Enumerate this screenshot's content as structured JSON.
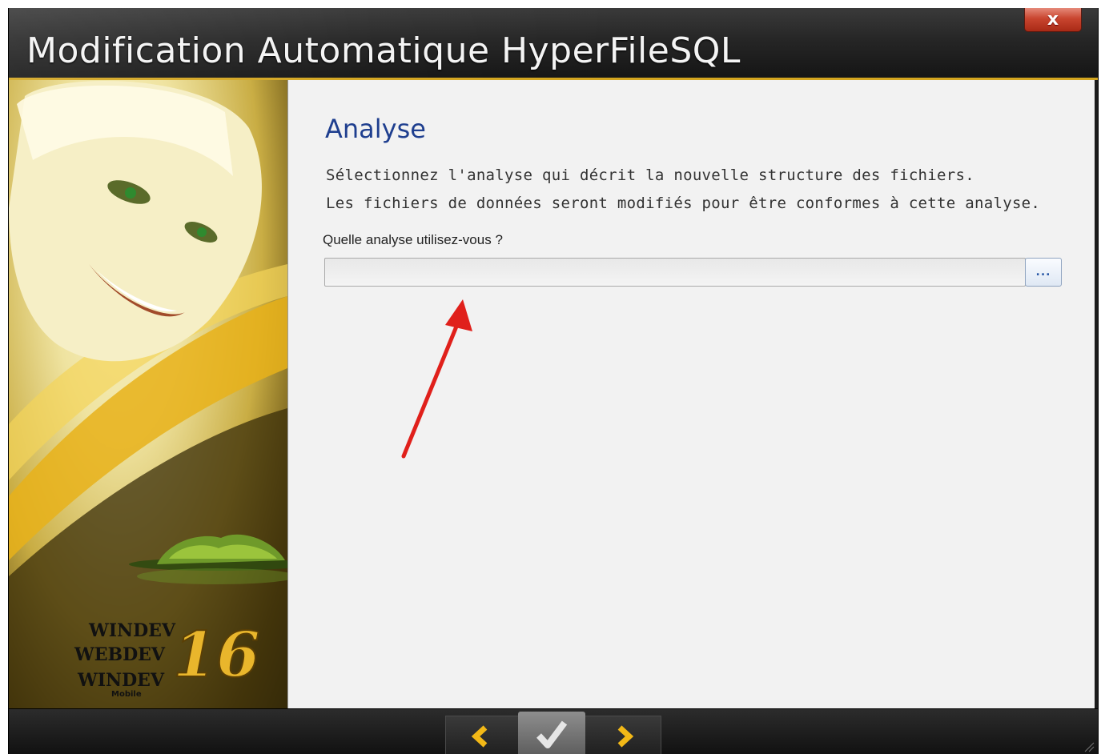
{
  "window": {
    "title": "Modification Automatique HyperFileSQL",
    "close_label": "x"
  },
  "side_panel": {
    "brand_lines": [
      "WINDEV",
      "WEBDEV",
      "WINDEV"
    ],
    "brand_sub": "Mobile",
    "version": "16"
  },
  "main": {
    "heading": "Analyse",
    "description_line1": "Sélectionnez l'analyse qui décrit la nouvelle structure des fichiers.",
    "description_line2": "Les fichiers de données seront modifiés pour être conformes à cette analyse.",
    "field_label": "Quelle analyse utilisez-vous ?",
    "field_value": "",
    "browse_label": "..."
  },
  "nav": {
    "prev_icon": "chevron-left-icon",
    "finish_icon": "checkmark-icon",
    "next_icon": "chevron-right-icon"
  },
  "colors": {
    "accent_gold": "#d3a51f",
    "heading_blue": "#1f3f8f",
    "annotation_red": "#e0201b"
  }
}
